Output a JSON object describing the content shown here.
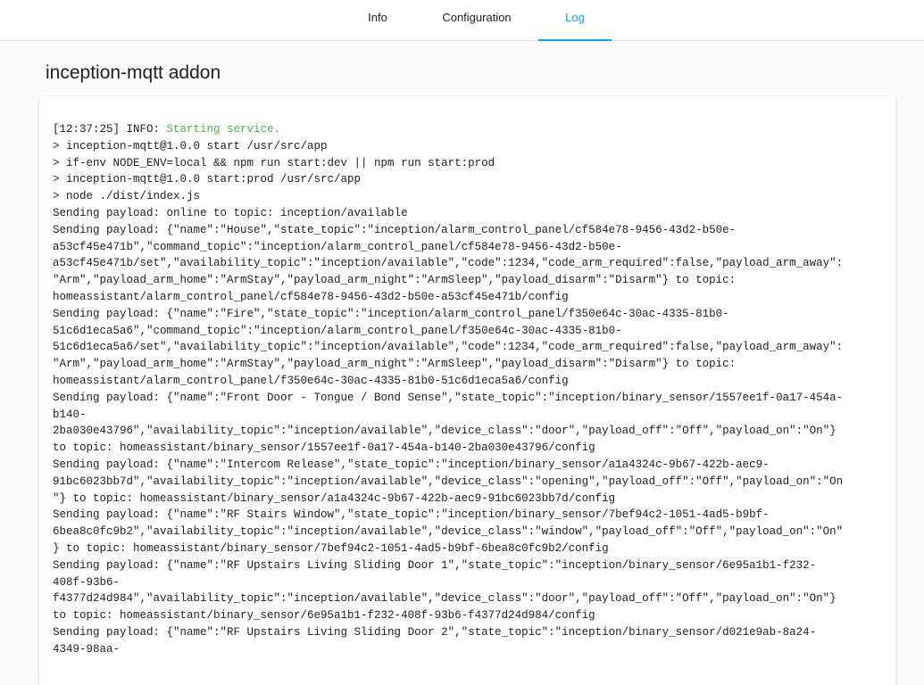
{
  "tabs": {
    "info": "Info",
    "configuration": "Configuration",
    "log": "Log",
    "active": "log"
  },
  "page": {
    "title": "inception-mqtt addon"
  },
  "log": {
    "first": {
      "prefix": "[12:37:25] INFO: ",
      "message": "Starting service."
    },
    "lines": [
      "> inception-mqtt@1.0.0 start /usr/src/app",
      "> if-env NODE_ENV=local && npm run start:dev || npm run start:prod",
      "> inception-mqtt@1.0.0 start:prod /usr/src/app",
      "> node ./dist/index.js",
      "Sending payload: online to topic: inception/available",
      "Sending payload: {\"name\":\"House\",\"state_topic\":\"inception/alarm_control_panel/cf584e78-9456-43d2-b50e-",
      "a53cf45e471b\",\"command_topic\":\"inception/alarm_control_panel/cf584e78-9456-43d2-b50e-",
      "a53cf45e471b/set\",\"availability_topic\":\"inception/available\",\"code\":1234,\"code_arm_required\":false,\"payload_arm_away\":",
      "\"Arm\",\"payload_arm_home\":\"ArmStay\",\"payload_arm_night\":\"ArmSleep\",\"payload_disarm\":\"Disarm\"} to topic:",
      "homeassistant/alarm_control_panel/cf584e78-9456-43d2-b50e-a53cf45e471b/config",
      "Sending payload: {\"name\":\"Fire\",\"state_topic\":\"inception/alarm_control_panel/f350e64c-30ac-4335-81b0-",
      "51c6d1eca5a6\",\"command_topic\":\"inception/alarm_control_panel/f350e64c-30ac-4335-81b0-",
      "51c6d1eca5a6/set\",\"availability_topic\":\"inception/available\",\"code\":1234,\"code_arm_required\":false,\"payload_arm_away\":",
      "\"Arm\",\"payload_arm_home\":\"ArmStay\",\"payload_arm_night\":\"ArmSleep\",\"payload_disarm\":\"Disarm\"} to topic:",
      "homeassistant/alarm_control_panel/f350e64c-30ac-4335-81b0-51c6d1eca5a6/config",
      "Sending payload: {\"name\":\"Front Door - Tongue / Bond Sense\",\"state_topic\":\"inception/binary_sensor/1557ee1f-0a17-454a-",
      "b140-",
      "2ba030e43796\",\"availability_topic\":\"inception/available\",\"device_class\":\"door\",\"payload_off\":\"Off\",\"payload_on\":\"On\"}",
      "to topic: homeassistant/binary_sensor/1557ee1f-0a17-454a-b140-2ba030e43796/config",
      "Sending payload: {\"name\":\"Intercom Release\",\"state_topic\":\"inception/binary_sensor/a1a4324c-9b67-422b-aec9-",
      "91bc6023bb7d\",\"availability_topic\":\"inception/available\",\"device_class\":\"opening\",\"payload_off\":\"Off\",\"payload_on\":\"On",
      "\"} to topic: homeassistant/binary_sensor/a1a4324c-9b67-422b-aec9-91bc6023bb7d/config",
      "Sending payload: {\"name\":\"RF Stairs Window\",\"state_topic\":\"inception/binary_sensor/7bef94c2-1051-4ad5-b9bf-",
      "6bea8c0fc9b2\",\"availability_topic\":\"inception/available\",\"device_class\":\"window\",\"payload_off\":\"Off\",\"payload_on\":\"On\"",
      "} to topic: homeassistant/binary_sensor/7bef94c2-1051-4ad5-b9bf-6bea8c0fc9b2/config",
      "Sending payload: {\"name\":\"RF Upstairs Living Sliding Door 1\",\"state_topic\":\"inception/binary_sensor/6e95a1b1-f232-",
      "408f-93b6-",
      "f4377d24d984\",\"availability_topic\":\"inception/available\",\"device_class\":\"door\",\"payload_off\":\"Off\",\"payload_on\":\"On\"}",
      "to topic: homeassistant/binary_sensor/6e95a1b1-f232-408f-93b6-f4377d24d984/config",
      "Sending payload: {\"name\":\"RF Upstairs Living Sliding Door 2\",\"state_topic\":\"inception/binary_sensor/d021e9ab-8a24-",
      "4349-98aa-"
    ]
  }
}
